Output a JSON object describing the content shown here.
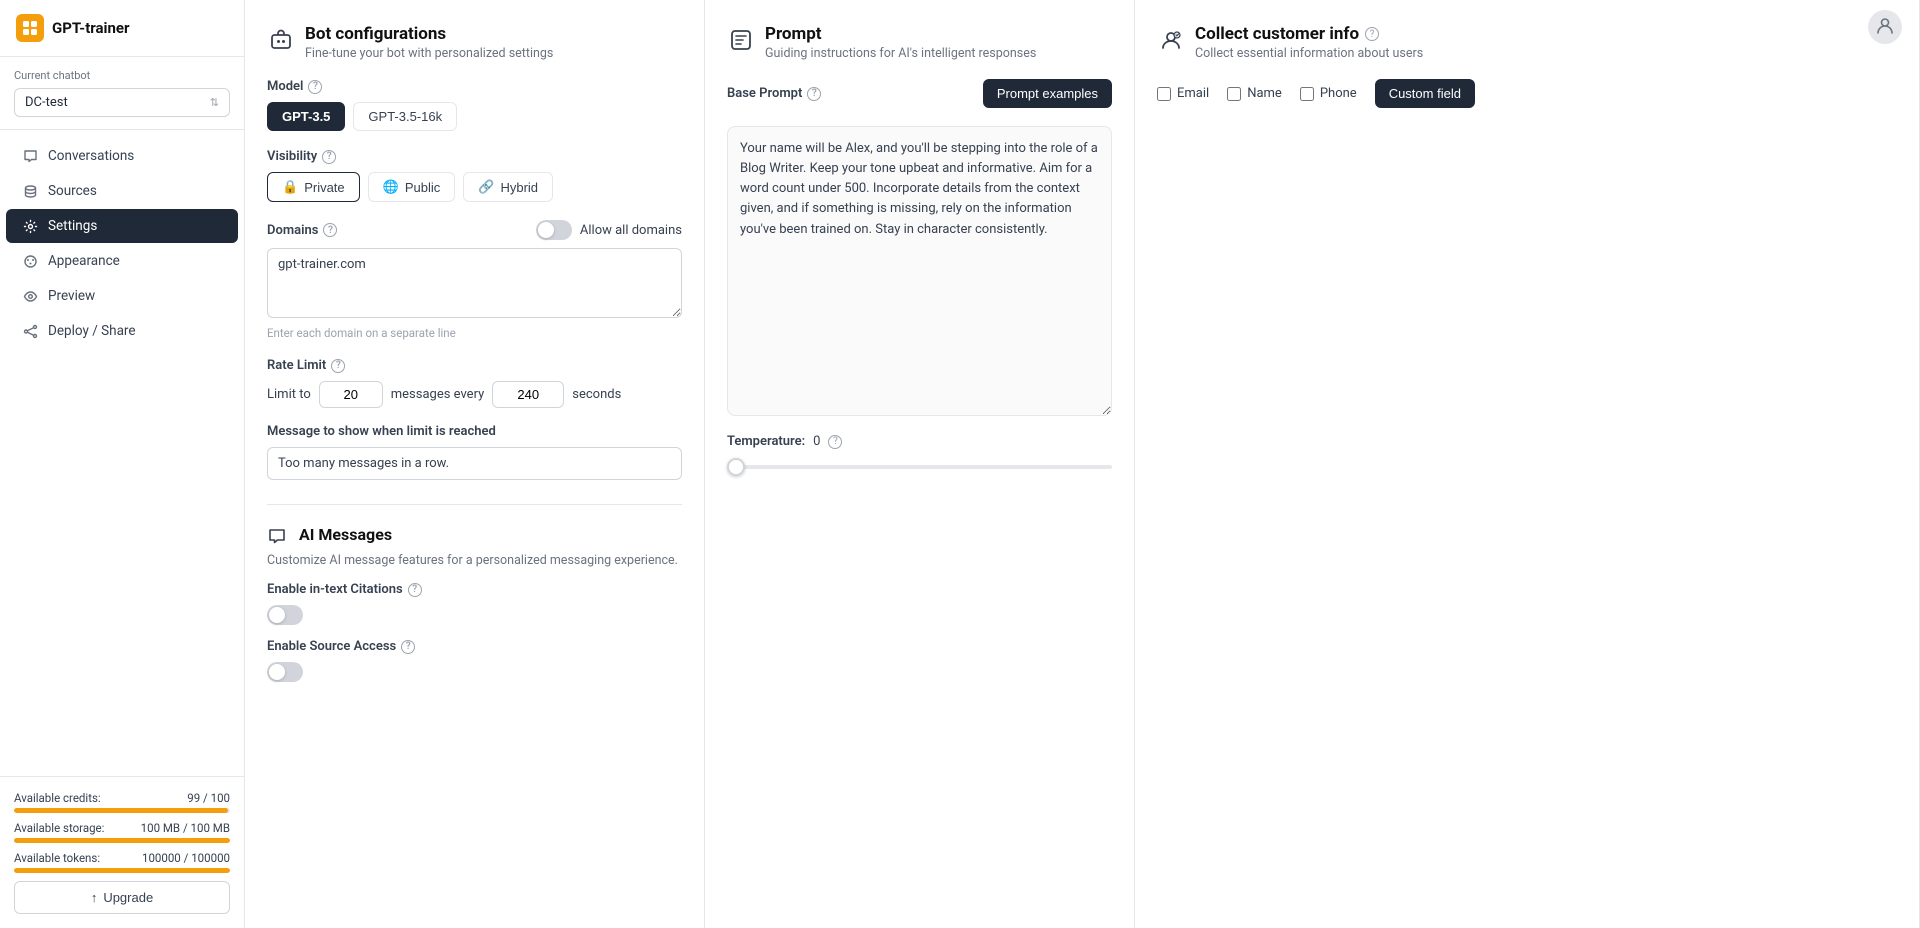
{
  "app": {
    "logo_text": "GPT-trainer",
    "user_avatar_label": "User avatar"
  },
  "sidebar": {
    "current_chatbot_label": "Current chatbot",
    "chatbot_name": "DC-test",
    "nav_items": [
      {
        "id": "conversations",
        "label": "Conversations",
        "icon": "chat-icon"
      },
      {
        "id": "sources",
        "label": "Sources",
        "icon": "database-icon"
      },
      {
        "id": "settings",
        "label": "Settings",
        "icon": "gear-icon",
        "active": true
      },
      {
        "id": "appearance",
        "label": "Appearance",
        "icon": "palette-icon"
      },
      {
        "id": "preview",
        "label": "Preview",
        "icon": "eye-icon"
      },
      {
        "id": "deploy-share",
        "label": "Deploy / Share",
        "icon": "share-icon"
      }
    ],
    "credits": {
      "available_credits_label": "Available credits:",
      "available_credits_value": "99 / 100",
      "available_credits_pct": 99,
      "available_storage_label": "Available storage:",
      "available_storage_value": "100 MB / 100 MB",
      "available_storage_pct": 100,
      "available_tokens_label": "Available tokens:",
      "available_tokens_value": "100000 / 100000",
      "available_tokens_pct": 100
    },
    "upgrade_btn_label": "Upgrade"
  },
  "bot_config": {
    "title": "Bot configurations",
    "subtitle": "Fine-tune your bot with personalized settings",
    "model_label": "Model",
    "model_options": [
      "GPT-3.5",
      "GPT-3.5-16k"
    ],
    "model_active": "GPT-3.5",
    "visibility_label": "Visibility",
    "visibility_options": [
      "Private",
      "Public",
      "Hybrid"
    ],
    "visibility_active": "Private",
    "domains_label": "Domains",
    "allow_all_domains_label": "Allow all domains",
    "allow_all_domains_on": false,
    "domains_value": "gpt-trainer.com",
    "domains_hint": "Enter each domain on a separate line",
    "rate_limit_label": "Rate Limit",
    "limit_to_label": "Limit to",
    "limit_messages_value": "20",
    "messages_every_label": "messages every",
    "limit_seconds_value": "240",
    "seconds_label": "seconds",
    "message_limit_label": "Message to show when limit is reached",
    "message_limit_value": "Too many messages in a row."
  },
  "ai_messages": {
    "title": "AI Messages",
    "subtitle": "Customize AI message features for a personalized messaging experience.",
    "enable_citations_label": "Enable in-text Citations",
    "enable_citations_on": false,
    "enable_source_access_label": "Enable Source Access",
    "enable_source_access_on": false
  },
  "prompt": {
    "title": "Prompt",
    "subtitle": "Guiding instructions for AI's intelligent responses",
    "base_prompt_label": "Base Prompt",
    "prompt_examples_btn": "Prompt examples",
    "prompt_text": "Your name will be Alex, and you'll be stepping into the role of a Blog Writer. Keep your tone upbeat and informative. Aim for a word count under 500. Incorporate details from the context given, and if something is missing, rely on the information you've been trained on. Stay in character consistently.",
    "temperature_label": "Temperature:",
    "temperature_value": "0",
    "temperature_slider_min": 0,
    "temperature_slider_max": 1,
    "temperature_slider_val": 0
  },
  "collect_info": {
    "title": "Collect customer info",
    "help_icon": true,
    "subtitle": "Collect essential information about users",
    "email_label": "Email",
    "email_checked": false,
    "name_label": "Name",
    "name_checked": false,
    "phone_label": "Phone",
    "phone_checked": false,
    "custom_field_btn": "Custom field"
  }
}
